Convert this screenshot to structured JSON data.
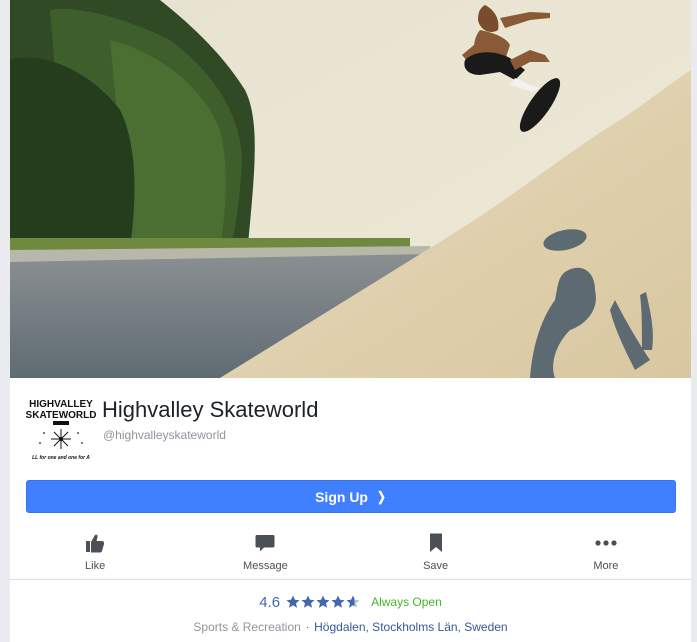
{
  "page": {
    "name": "Highvalley Skateworld",
    "handle": "@highvalleyskateworld",
    "logo_text_line1": "HIGHVALLEY",
    "logo_text_line2": "SKATEWORLD",
    "logo_tagline": "LL for one and one for A"
  },
  "signup": {
    "label": "Sign Up",
    "chevron_icon": "chevron-right-icon"
  },
  "actions": [
    {
      "label": "Like",
      "icon": "thumbs-up-icon"
    },
    {
      "label": "Message",
      "icon": "speech-bubble-icon"
    },
    {
      "label": "Save",
      "icon": "bookmark-icon"
    },
    {
      "label": "More",
      "icon": "ellipsis-icon"
    }
  ],
  "info": {
    "rating": "4.6",
    "stars": 4.6,
    "open_status": "Always Open",
    "category": "Sports & Recreation",
    "separator": "·",
    "location": "Högdalen, Stockholms Län, Sweden"
  },
  "colors": {
    "primary_button": "#4080ff",
    "link_blue": "#365899",
    "star_blue": "#4267b2",
    "open_green": "#42b72a"
  }
}
